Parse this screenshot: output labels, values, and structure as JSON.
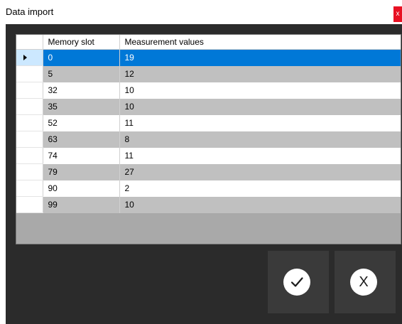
{
  "window": {
    "title": "Data import",
    "close_glyph": "x"
  },
  "grid": {
    "columns": [
      "Memory slot",
      "Measurement values"
    ],
    "rows": [
      [
        "0",
        "19"
      ],
      [
        "5",
        "12"
      ],
      [
        "32",
        "10"
      ],
      [
        "35",
        "10"
      ],
      [
        "52",
        "11"
      ],
      [
        "63",
        "8"
      ],
      [
        "74",
        "11"
      ],
      [
        "79",
        "27"
      ],
      [
        "90",
        "2"
      ],
      [
        "99",
        "10"
      ]
    ],
    "selected_row": 0
  },
  "buttons": {
    "ok_icon": "checkmark-icon",
    "cancel_icon": "x-icon",
    "cancel_glyph": "X"
  },
  "colors": {
    "selection": "#0078d7",
    "alt_row": "#c0c0c0",
    "background": "#2b2b2b",
    "close": "#e81123"
  }
}
